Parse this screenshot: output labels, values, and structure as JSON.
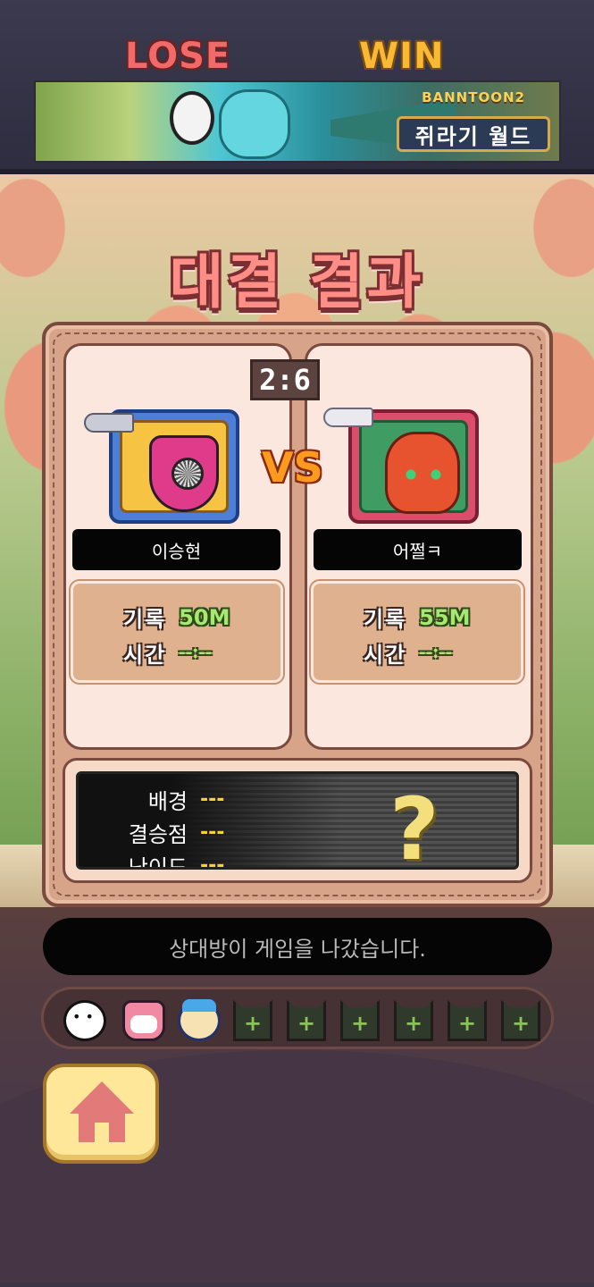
{
  "banner": {
    "series": "BANNTOON2",
    "title": "쥐라기 월드"
  },
  "page_title": "대결 결과",
  "match": {
    "score": "2:6",
    "vs_label": "VS",
    "left": {
      "result": "LOSE",
      "name": "이승현",
      "record_label": "기록",
      "record_value": "50M",
      "time_label": "시간",
      "time_value": "--:--"
    },
    "right": {
      "result": "WIN",
      "name": "어쩔ㅋ",
      "record_label": "기록",
      "record_value": "55M",
      "time_label": "시간",
      "time_value": "--:--"
    }
  },
  "map_info": {
    "rows": [
      {
        "label": "배경",
        "value": "---"
      },
      {
        "label": "결승점",
        "value": "---"
      },
      {
        "label": "난이도",
        "value": "---"
      }
    ],
    "unknown_mark": "?"
  },
  "status_message": "상대방이 게임을 나갔습니다.",
  "emotes": {
    "slot_label": "+"
  },
  "colors": {
    "lose": "#f06a6a",
    "win": "#f9b933",
    "stat_value": "#a6e870",
    "map_value": "#f5d233"
  }
}
